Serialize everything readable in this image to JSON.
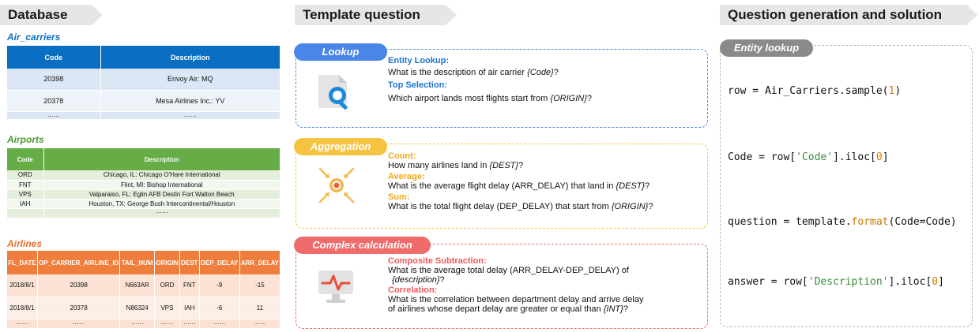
{
  "headers": {
    "database": "Database",
    "template": "Template question",
    "generation": "Question generation and solution"
  },
  "colors": {
    "carriers": "#0a6fc2",
    "airports": "#66ad46",
    "airlines": "#ef7d3c",
    "lookup": "#4a86e8",
    "aggregation": "#f5c242",
    "complex": "#f06b6b",
    "entity_lookup": "#8a8a8a"
  },
  "database": {
    "air_carriers": {
      "title": "Air_carriers",
      "columns": [
        "Code",
        "Description"
      ],
      "rows": [
        [
          "20398",
          "Envoy Air: MQ"
        ],
        [
          "20378",
          "Mesa Airlines Inc.: YV"
        ],
        [
          "……",
          "……"
        ]
      ]
    },
    "airports": {
      "title": "Airports",
      "columns": [
        "Code",
        "Description"
      ],
      "rows": [
        [
          "ORD",
          "Chicago, IL: Chicago O'Hare International"
        ],
        [
          "FNT",
          "Flint, MI: Bishop International"
        ],
        [
          "VPS",
          "Valparaiso, FL: Eglin AFB Destin Fort Walton Beach"
        ],
        [
          "IAH",
          "Houston, TX: George Bush Intercontinental/Houston"
        ],
        [
          "",
          "……"
        ]
      ]
    },
    "airlines": {
      "title": "Airlines",
      "columns": [
        "FL_DATE",
        "OP_CARRIER_AIRLINE_ID",
        "TAIL_NUM",
        "ORIGIN",
        "DEST",
        "DEP_DELAY",
        "ARR_DELAY"
      ],
      "rows": [
        [
          "2018/8/1",
          "20398",
          "N663AR",
          "ORD",
          "FNT",
          "-9",
          "-15"
        ],
        [
          "2018/8/1",
          "20378",
          "N86324",
          "VPS",
          "IAH",
          "-6",
          "11"
        ],
        [
          "……",
          "……",
          "……",
          "……",
          "……",
          "……",
          "……"
        ]
      ]
    }
  },
  "templates": {
    "lookup": {
      "tag": "Lookup",
      "icon": "magnifier-icon",
      "items": [
        {
          "heading": "Entity Lookup:",
          "before": "What is the description of air carrier ",
          "var": "{Code}",
          "after": "?"
        },
        {
          "heading": "Top Selection:",
          "before": "Which airport lands most flights start from ",
          "var": "{ORIGIN}",
          "after": "?"
        }
      ]
    },
    "aggregation": {
      "tag": "Aggregation",
      "icon": "aggregate-arrows-icon",
      "items": [
        {
          "heading": "Count:",
          "before": "How many airlines land in ",
          "var": "{DEST}",
          "after": "?"
        },
        {
          "heading": "Average:",
          "before": "What is the average flight delay (ARR_DELAY) that land in ",
          "var": "{DEST}",
          "after": "?"
        },
        {
          "heading": "Sum:",
          "before": "What is the total flight delay (DEP_DELAY) that start from ",
          "var": "{ORIGIN}",
          "after": "?"
        }
      ]
    },
    "complex": {
      "tag": "Complex calculation",
      "icon": "monitor-pulse-icon",
      "items": [
        {
          "heading": "Composite Subtraction:",
          "line1": "What is the average total delay (ARR_DELAY-DEP_DELAY) of",
          "var": "{description}",
          "after": "?"
        },
        {
          "heading": "Correlation:",
          "line1": "What is the correlation between department delay and arrive delay",
          "line2_before": "of airlines whose depart delay are greater or equal than ",
          "var": "{INT}",
          "after": "?"
        }
      ]
    }
  },
  "solution": {
    "tag": "Entity lookup",
    "code": [
      {
        "a": "row = Air_Carriers.sample(",
        "num": "1",
        "b": ")"
      },
      {
        "a": "Code = row[",
        "str": "'Code'",
        "b": "].iloc[",
        "num": "0",
        "c": "]"
      },
      {
        "a": "question = template.",
        "fn": "format",
        "b": "(Code=Code)"
      },
      {
        "a": "answer = row[",
        "str": "'Description'",
        "b": "].iloc[",
        "num": "0",
        "c": "]"
      }
    ]
  }
}
